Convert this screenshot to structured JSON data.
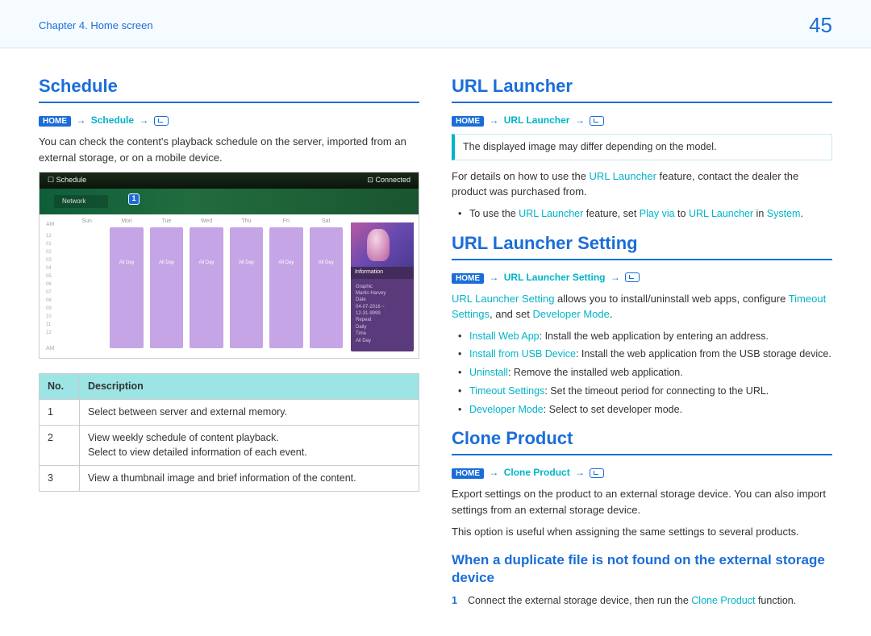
{
  "header": {
    "chapter": "Chapter 4. Home screen",
    "page": "45"
  },
  "left": {
    "schedule": {
      "title": "Schedule",
      "bc_home": "HOME",
      "bc_link": "Schedule",
      "intro": "You can check the content's playback schedule on the server, imported from an external storage, or on a mobile device.",
      "mock": {
        "topbar_left": "☐ Schedule",
        "topbar_right": "⊡ Connected",
        "network": "Network",
        "days": [
          "Sun",
          "Mon",
          "Tue",
          "Wed",
          "Thu",
          "Fri",
          "Sat"
        ],
        "ampm_top": "AM",
        "ampm_bot": "AM",
        "hours": [
          "12",
          "01",
          "02",
          "03",
          "04",
          "05",
          "06",
          "07",
          "08",
          "09",
          "10",
          "11",
          "12"
        ],
        "allday": "All Day",
        "info_title": "Information",
        "info_lines": [
          "Graphic",
          "Martin Harvey",
          "",
          "Date",
          "04-07-2016 ~",
          "12-31-9999",
          "",
          "Repeat",
          "Daily",
          "",
          "Time",
          "All Day"
        ]
      },
      "table": {
        "h1": "No.",
        "h2": "Description",
        "rows": [
          {
            "n": "1",
            "d": "Select between server and external memory."
          },
          {
            "n": "2",
            "d": "View weekly schedule of content playback.\nSelect to view detailed information of each event."
          },
          {
            "n": "3",
            "d": "View a thumbnail image and brief information of the content."
          }
        ]
      }
    }
  },
  "right": {
    "url_launcher": {
      "title": "URL Launcher",
      "bc_home": "HOME",
      "bc_link": "URL Launcher",
      "note": "The displayed image may differ depending on the model.",
      "p1a": "For details on how to use the ",
      "p1b": "URL Launcher",
      "p1c": " feature, contact the dealer the product was purchased from.",
      "b1a": "To use the ",
      "b1b": "URL Launcher",
      "b1c": " feature, set ",
      "b1d": "Play via",
      "b1e": " to ",
      "b1f": "URL Launcher",
      "b1g": " in ",
      "b1h": "System",
      "b1i": "."
    },
    "url_setting": {
      "title": "URL Launcher Setting",
      "bc_home": "HOME",
      "bc_link": "URL Launcher Setting",
      "p1a": "URL Launcher Setting",
      "p1b": " allows you to install/uninstall web apps, configure ",
      "p1c": "Timeout Settings",
      "p1d": ", and set ",
      "p1e": "Developer Mode",
      "p1f": ".",
      "items": [
        {
          "t": "Install Web App",
          "d": ": Install the web application by entering an address."
        },
        {
          "t": "Install from USB Device",
          "d": ": Install the web application from the USB storage device."
        },
        {
          "t": "Uninstall",
          "d": ": Remove the installed web application."
        },
        {
          "t": "Timeout Settings",
          "d": ": Set the timeout period for connecting to the URL."
        },
        {
          "t": "Developer Mode",
          "d": ": Select to set developer mode."
        }
      ]
    },
    "clone": {
      "title": "Clone Product",
      "bc_home": "HOME",
      "bc_link": "Clone Product",
      "p1": "Export settings on the product to an external storage device. You can also import settings from an external storage device.",
      "p2": "This option is useful when assigning the same settings to several products.",
      "sub": "When a duplicate file is not found on the external storage device",
      "step1a": "Connect the external storage device, then run the ",
      "step1b": "Clone Product",
      "step1c": " function."
    }
  }
}
